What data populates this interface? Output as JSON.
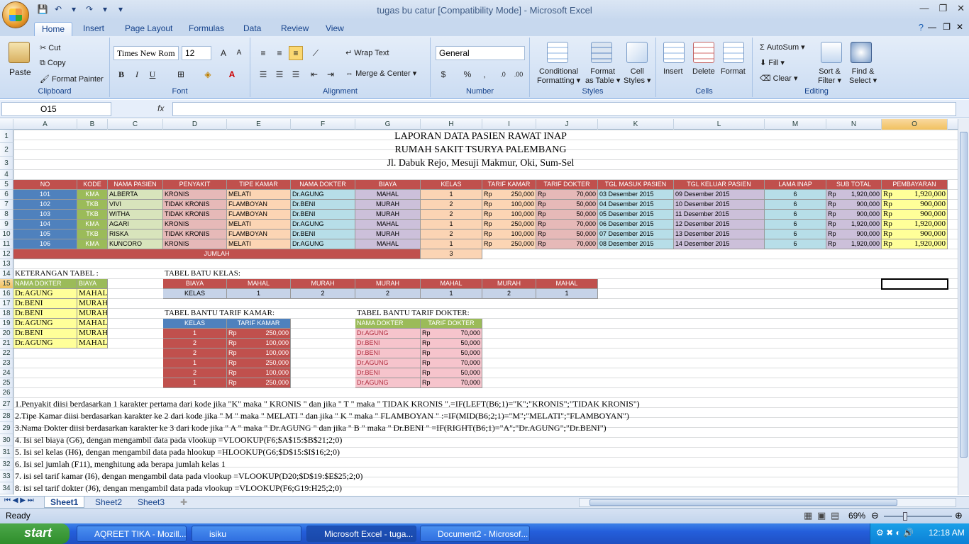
{
  "window": {
    "title": "tugas bu catur  [Compatibility Mode] - Microsoft Excel",
    "controls": [
      "—",
      "❐",
      "✕"
    ]
  },
  "qat": [
    "💾",
    "↶",
    "▾",
    "↷",
    "▾",
    "▾"
  ],
  "tabs": [
    "Home",
    "Insert",
    "Page Layout",
    "Formulas",
    "Data",
    "Review",
    "View"
  ],
  "ribbon": {
    "clipboard": {
      "label": "Clipboard",
      "paste": "Paste",
      "cut": "Cut",
      "copy": "Copy",
      "format_painter": "Format Painter"
    },
    "font": {
      "label": "Font",
      "family": "Times New Rom",
      "size": "12",
      "bold": "B",
      "italic": "I",
      "underline": "U"
    },
    "alignment": {
      "label": "Alignment",
      "wrap": "Wrap Text",
      "merge": "Merge & Center"
    },
    "number": {
      "label": "Number",
      "format": "General",
      "currency": "$",
      "percent": "%",
      "comma": ","
    },
    "styles": {
      "label": "Styles",
      "cond": "Conditional",
      "cond2": "Formatting",
      "fmt_table": "Format",
      "fmt_table2": "as Table",
      "cell_styles": "Cell",
      "cell_styles2": "Styles"
    },
    "cells": {
      "label": "Cells",
      "insert": "Insert",
      "delete": "Delete",
      "format": "Format"
    },
    "editing": {
      "label": "Editing",
      "autosum": "AutoSum",
      "fill": "Fill",
      "clear": "Clear",
      "sort": "Sort &",
      "sort2": "Filter",
      "find": "Find &",
      "find2": "Select"
    }
  },
  "formula_bar": {
    "name_box": "O15",
    "fx": "fx",
    "content": ""
  },
  "columns": [
    "A",
    "B",
    "C",
    "D",
    "E",
    "F",
    "G",
    "H",
    "I",
    "J",
    "K",
    "L",
    "M",
    "N",
    "O"
  ],
  "rows": [
    "1",
    "2",
    "3",
    "4",
    "5",
    "6",
    "7",
    "8",
    "9",
    "10",
    "11",
    "12",
    "13",
    "14",
    "15",
    "16",
    "17",
    "18",
    "19",
    "20",
    "21",
    "22",
    "23",
    "24",
    "25",
    "26",
    "27",
    "28",
    "29",
    "30",
    "31",
    "32",
    "33",
    "34"
  ],
  "report": {
    "title1": "LAPORAN DATA PASIEN RAWAT INAP",
    "title2": "RUMAH SAKIT TSURYA PALEMBANG",
    "title3": "Jl. Dabuk Rejo, Mesuji Makmur, Oki, Sum-Sel"
  },
  "main_headers": [
    "NO",
    "KODE",
    "NAMA PASIEN",
    "PENYAKIT",
    "TIPE KAMAR",
    "NAMA DOKTER",
    "BIAYA",
    "KELAS",
    "TARIF KAMAR",
    "TARIF DOKTER",
    "TGL MASUK PASIEN",
    "TGL KELUAR PASIEN",
    "LAMA INAP",
    "SUB TOTAL",
    "PEMBAYARAN"
  ],
  "main_rows": [
    [
      "101",
      "KMA",
      "ALBERTA",
      "KRONIS",
      "MELATI",
      "Dr.AGUNG",
      "MAHAL",
      "1",
      "250,000",
      "70,000",
      "03 Desember 2015",
      "09 Desember 2015",
      "6",
      "1,920,000",
      "1,920,000"
    ],
    [
      "102",
      "TKB",
      "VIVI",
      "TIDAK KRONIS",
      "FLAMBOYAN",
      "Dr.BENI",
      "MURAH",
      "2",
      "100,000",
      "50,000",
      "04 Desember 2015",
      "10 Desember 2015",
      "6",
      "900,000",
      "900,000"
    ],
    [
      "103",
      "TKB",
      "WITHA",
      "TIDAK KRONIS",
      "FLAMBOYAN",
      "Dr.BENI",
      "MURAH",
      "2",
      "100,000",
      "50,000",
      "05 Desember 2015",
      "11 Desember 2015",
      "6",
      "900,000",
      "900,000"
    ],
    [
      "104",
      "KMA",
      "AGARI",
      "KRONIS",
      "MELATI",
      "Dr.AGUNG",
      "MAHAL",
      "1",
      "250,000",
      "70,000",
      "06 Desember 2015",
      "12 Desember 2015",
      "6",
      "1,920,000",
      "1,920,000"
    ],
    [
      "105",
      "TKB",
      "RISKA",
      "TIDAK KRONIS",
      "FLAMBOYAN",
      "Dr.BENI",
      "MURAH",
      "2",
      "100,000",
      "50,000",
      "07 Desember 2015",
      "13 Desember 2015",
      "6",
      "900,000",
      "900,000"
    ],
    [
      "106",
      "KMA",
      "KUNCORO",
      "KRONIS",
      "MELATI",
      "Dr.AGUNG",
      "MAHAL",
      "1",
      "250,000",
      "70,000",
      "08 Desember 2015",
      "14 Desember 2015",
      "6",
      "1,920,000",
      "1,920,000"
    ]
  ],
  "currency": "Rp",
  "jumlah": {
    "label": "JUMLAH",
    "value": "3"
  },
  "keterangan": {
    "title": "KETERANGAN TABEL :",
    "headers": [
      "NAMA DOKTER",
      "BIAYA"
    ],
    "rows": [
      [
        "Dr.AGUNG",
        "MAHAL"
      ],
      [
        "Dr.BENI",
        "MURAH"
      ],
      [
        "Dr.BENI",
        "MURAH"
      ],
      [
        "Dr.AGUNG",
        "MAHAL"
      ],
      [
        "Dr.BENI",
        "MURAH"
      ],
      [
        "Dr.AGUNG",
        "MAHAL"
      ]
    ]
  },
  "batu_kelas": {
    "title": "TABEL BATU KELAS:",
    "row1": [
      "BIAYA",
      "MAHAL",
      "MURAH",
      "MURAH",
      "MAHAL",
      "MURAH",
      "MAHAL"
    ],
    "row2": [
      "KELAS",
      "1",
      "2",
      "2",
      "1",
      "2",
      "1"
    ]
  },
  "tarif_kamar": {
    "title": "TABEL BANTU TARIF KAMAR:",
    "headers": [
      "KELAS",
      "TARIF KAMAR"
    ],
    "rows": [
      [
        "1",
        "250,000"
      ],
      [
        "2",
        "100,000"
      ],
      [
        "2",
        "100,000"
      ],
      [
        "1",
        "250,000"
      ],
      [
        "2",
        "100,000"
      ],
      [
        "1",
        "250,000"
      ]
    ]
  },
  "tarif_dokter": {
    "title": "TABEL BANTU TARIF DOKTER:",
    "headers": [
      "NAMA DOKTER",
      "TARIF DOKTER"
    ],
    "rows": [
      [
        "Dr.AGUNG",
        "70,000"
      ],
      [
        "Dr.BENI",
        "50,000"
      ],
      [
        "Dr.BENI",
        "50,000"
      ],
      [
        "Dr.AGUNG",
        "70,000"
      ],
      [
        "Dr.BENI",
        "50,000"
      ],
      [
        "Dr.AGUNG",
        "70,000"
      ]
    ]
  },
  "notes": [
    "1.Penyakit diisi berdasarkan 1 karakter pertama dari kode jika \"K\" maka \" KRONIS \" dan jika \" T \" maka \" TIDAK KRONIS \".=IF(LEFT(B6;1)=\"K\";\"KRONIS\";\"TIDAK KRONIS\")",
    "2.Tipe Kamar diisi berdasarkan karakter ke 2 dari kode jika \" M \" maka \" MELATI \" dan jika \" K \" maka \" FLAMBOYAN \"  :=IF(MID(B6;2;1)=\"M\";\"MELATI\";\"FLAMBOYAN\")",
    "3.Nama Dokter diisi berdasarkan karakter ke 3 dari kode jika \" A \" maka \" Dr.AGUNG \" dan jika \" B \" maka \" Dr.BENI \" =IF(RIGHT(B6;1)=\"A\";\"Dr.AGUNG\";\"Dr.BENI\")",
    "4. Isi sel biaya (G6), dengan mengambil data pada vlookup  =VLOOKUP(F6;$A$15:$B$21;2;0)",
    "5. Isi sel kelas (H6), dengan mengambil data pada hlookup  =HLOOKUP(G6;$D$15:$I$16;2;0)",
    "6. Isi sel jumlah (F11), menghitung ada berapa jumlah kelas 1",
    "7. isi sel tarif kamar (I6), dengan mengambil data pada vlookup  =VLOOKUP(D20;$D$19:$E$25;2;0)",
    "8. isi sel tarif dokter (J6), dengan mengambil data pada vlookup  =VLOOKUP(F6;G19:H25;2;0)"
  ],
  "sheet_tabs": [
    "Sheet1",
    "Sheet2",
    "Sheet3"
  ],
  "status": {
    "ready": "Ready",
    "zoom": "69%"
  },
  "taskbar": {
    "start": "start",
    "tasks": [
      "AQREET TIKA - Mozill...",
      "isiku",
      "Microsoft Excel - tuga...",
      "Document2 - Microsof..."
    ],
    "clock": "12:18 AM"
  },
  "colors": {
    "red": "#c0504d",
    "blue": "#4f81bd",
    "green": "#9bbb59",
    "rose": "#e6b9b8",
    "peach": "#fcd5b4",
    "lav": "#ccc0da",
    "lblue": "#b7dee8",
    "yellow": "#ffff99",
    "lgreen": "#d8e4bc",
    "orange": "#fbd4b4"
  }
}
